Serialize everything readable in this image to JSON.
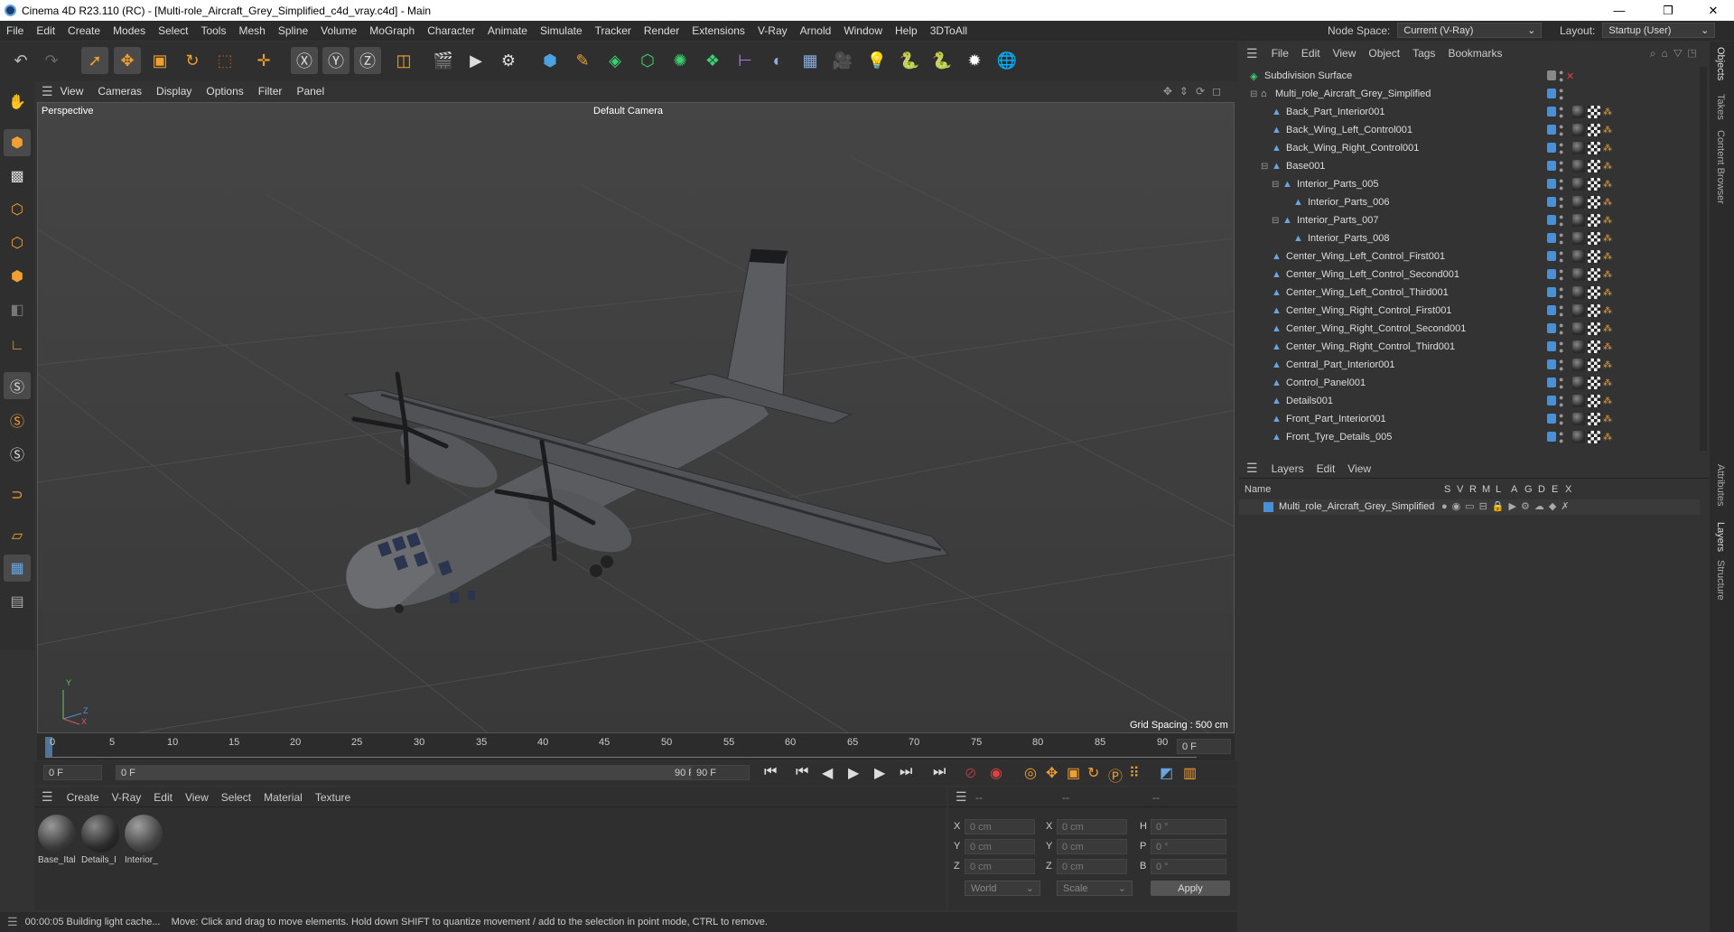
{
  "window": {
    "title": "Cinema 4D R23.110 (RC) - [Multi-role_Aircraft_Grey_Simplified_c4d_vray.c4d] - Main",
    "minimize": "—",
    "maximize": "❐",
    "close": "✕"
  },
  "menubar": {
    "items": [
      "File",
      "Edit",
      "Create",
      "Modes",
      "Select",
      "Tools",
      "Mesh",
      "Spline",
      "Volume",
      "MoGraph",
      "Character",
      "Animate",
      "Simulate",
      "Tracker",
      "Render",
      "Extensions",
      "V-Ray",
      "Arnold",
      "Window",
      "Help",
      "3DToAll"
    ],
    "node_space_label": "Node Space:",
    "node_space_value": "Current (V-Ray)",
    "layout_label": "Layout:",
    "layout_value": "Startup (User)"
  },
  "viewport": {
    "menu": [
      "View",
      "Cameras",
      "Display",
      "Options",
      "Filter",
      "Panel"
    ],
    "view_name": "Perspective",
    "camera": "Default Camera",
    "grid_spacing": "Grid Spacing : 500 cm",
    "axis_y": "Y",
    "axis_z": "Z",
    "axis_x": "X"
  },
  "timeline": {
    "ticks": [
      "0",
      "5",
      "10",
      "15",
      "20",
      "25",
      "30",
      "35",
      "40",
      "45",
      "50",
      "55",
      "60",
      "65",
      "70",
      "75",
      "80",
      "85",
      "90"
    ],
    "current_frame": "0 F",
    "start_field": "0 F",
    "range_start": "0 F",
    "range_end": "90 F",
    "end_field": "90 F"
  },
  "material_manager": {
    "menu": [
      "Create",
      "V-Ray",
      "Edit",
      "View",
      "Select",
      "Material",
      "Texture"
    ],
    "materials": [
      "Base_Ital",
      "Details_I",
      "Interior_"
    ]
  },
  "coordinates": {
    "headers": [
      "--",
      "--",
      "--"
    ],
    "rows": [
      {
        "a": "X",
        "av": "0 cm",
        "b": "X",
        "bv": "0 cm",
        "c": "H",
        "cv": "0 °"
      },
      {
        "a": "Y",
        "av": "0 cm",
        "b": "Y",
        "bv": "0 cm",
        "c": "P",
        "cv": "0 °"
      },
      {
        "a": "Z",
        "av": "0 cm",
        "b": "Z",
        "bv": "0 cm",
        "c": "B",
        "cv": "0 °"
      }
    ],
    "space": "World",
    "mode": "Scale",
    "apply": "Apply"
  },
  "status": {
    "time": "00:00:05 Building light cache...",
    "message": "Move: Click and drag to move elements. Hold down SHIFT to quantize movement / add to the selection in point mode, CTRL to remove."
  },
  "object_manager": {
    "menu": [
      "File",
      "Edit",
      "View",
      "Object",
      "Tags",
      "Bookmarks"
    ],
    "objects": [
      {
        "name": "Subdivision Surface",
        "indent": 0,
        "icon": "subdivision-icon"
      },
      {
        "name": "Multi_role_Aircraft_Grey_Simplified",
        "indent": 1,
        "icon": "null-icon"
      },
      {
        "name": "Back_Part_Interior001",
        "indent": 2,
        "icon": "polygon-icon"
      },
      {
        "name": "Back_Wing_Left_Control001",
        "indent": 2,
        "icon": "polygon-icon"
      },
      {
        "name": "Back_Wing_Right_Control001",
        "indent": 2,
        "icon": "polygon-icon"
      },
      {
        "name": "Base001",
        "indent": 2,
        "icon": "polygon-icon"
      },
      {
        "name": "Interior_Parts_005",
        "indent": 3,
        "icon": "polygon-icon"
      },
      {
        "name": "Interior_Parts_006",
        "indent": 4,
        "icon": "polygon-icon"
      },
      {
        "name": "Interior_Parts_007",
        "indent": 3,
        "icon": "polygon-icon"
      },
      {
        "name": "Interior_Parts_008",
        "indent": 4,
        "icon": "polygon-icon"
      },
      {
        "name": "Center_Wing_Left_Control_First001",
        "indent": 2,
        "icon": "polygon-icon"
      },
      {
        "name": "Center_Wing_Left_Control_Second001",
        "indent": 2,
        "icon": "polygon-icon"
      },
      {
        "name": "Center_Wing_Left_Control_Third001",
        "indent": 2,
        "icon": "polygon-icon"
      },
      {
        "name": "Center_Wing_Right_Control_First001",
        "indent": 2,
        "icon": "polygon-icon"
      },
      {
        "name": "Center_Wing_Right_Control_Second001",
        "indent": 2,
        "icon": "polygon-icon"
      },
      {
        "name": "Center_Wing_Right_Control_Third001",
        "indent": 2,
        "icon": "polygon-icon"
      },
      {
        "name": "Central_Part_Interior001",
        "indent": 2,
        "icon": "polygon-icon"
      },
      {
        "name": "Control_Panel001",
        "indent": 2,
        "icon": "polygon-icon"
      },
      {
        "name": "Details001",
        "indent": 2,
        "icon": "polygon-icon"
      },
      {
        "name": "Front_Part_Interior001",
        "indent": 2,
        "icon": "polygon-icon"
      },
      {
        "name": "Front_Tyre_Details_005",
        "indent": 2,
        "icon": "polygon-icon"
      }
    ]
  },
  "layer_manager": {
    "menu": [
      "Layers",
      "Edit",
      "View"
    ],
    "columns": [
      "Name",
      "S",
      "V",
      "R",
      "M",
      "L",
      "A",
      "G",
      "D",
      "E",
      "X"
    ],
    "layers": [
      {
        "name": "Multi_role_Aircraft_Grey_Simplified",
        "color": "#4a90d9"
      }
    ]
  },
  "side_tabs": [
    "Objects",
    "Takes",
    "Content Browser",
    "Attributes",
    "Layers",
    "Structure"
  ],
  "colors": {
    "accent": "#4a90d9",
    "orange": "#e8a03a",
    "bg": "#333333"
  }
}
